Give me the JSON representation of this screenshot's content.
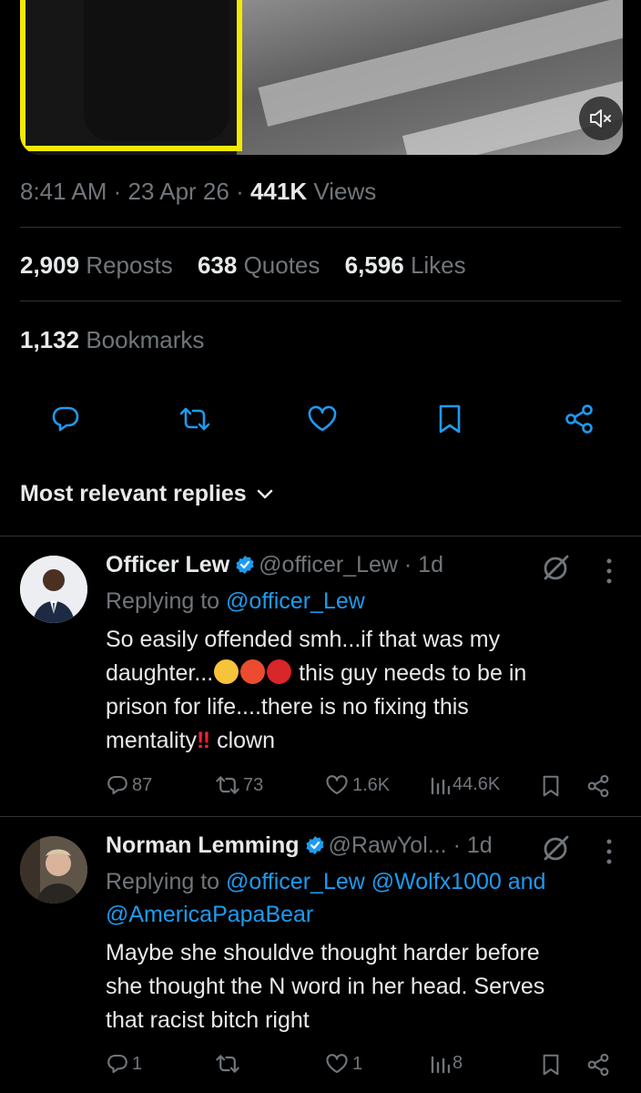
{
  "post": {
    "time": "8:41 AM",
    "date": "23 Apr 26",
    "views_count": "441K",
    "views_label": "Views",
    "reposts_count": "2,909",
    "reposts_label": "Reposts",
    "quotes_count": "638",
    "quotes_label": "Quotes",
    "likes_count": "6,596",
    "likes_label": "Likes",
    "bookmarks_count": "1,132",
    "bookmarks_label": "Bookmarks"
  },
  "sort": {
    "label": "Most relevant replies"
  },
  "replies": [
    {
      "name": "Officer Lew",
      "handle": "@officer_Lew",
      "age": "· 1d",
      "replying_prefix": "Replying to",
      "replying_to": "@officer_Lew",
      "text_line1": "So easily offended smh...if that was my",
      "text_line2a": "daughter...",
      "text_line2b": " this guy needs to be in",
      "text_line3": "prison for life....there is no fixing this",
      "text_line4a": "mentality",
      "text_line4b": " clown",
      "comments": "87",
      "reposts": "73",
      "likes": "1.6K",
      "views": "44.6K"
    },
    {
      "name": "Norman Lemming",
      "handle": "@RawYol...",
      "age": "· 1d",
      "replying_prefix": "Replying to",
      "replying_to": "@officer_Lew @Wolfx1000 and",
      "replying_to2": "@AmericaPapaBear",
      "text_line1": "Maybe she shouldve thought harder before",
      "text_line2": "she thought the N word in her head. Serves",
      "text_line3": "that racist bitch right",
      "comments": "1",
      "reposts": "",
      "likes": "1",
      "views": "8"
    }
  ],
  "colors": {
    "background": "#000000",
    "text": "#e7e9ea",
    "secondary": "#71767b",
    "link": "#1d9bf0",
    "verified": "#1d9bf0",
    "divider": "#2f3336",
    "highlight_frame": "#f4e900"
  }
}
